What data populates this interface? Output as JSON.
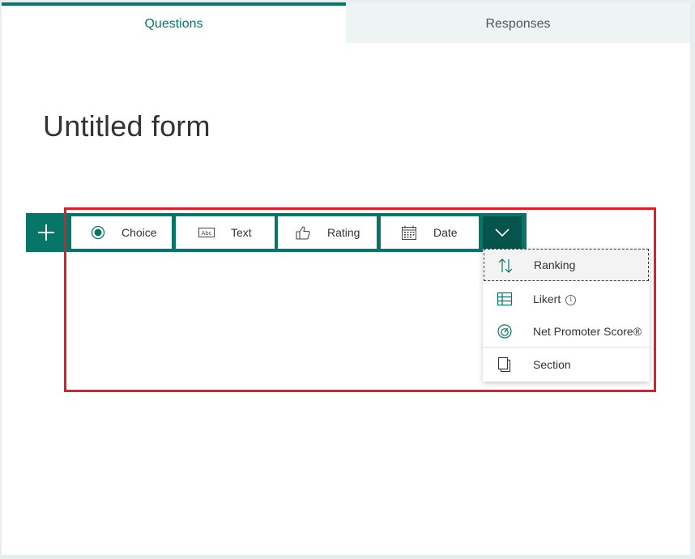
{
  "tabs": {
    "questions": "Questions",
    "responses": "Responses"
  },
  "form": {
    "title": "Untitled form"
  },
  "toolbar": {
    "choice": "Choice",
    "text": "Text",
    "rating": "Rating",
    "date": "Date"
  },
  "menu": {
    "ranking": "Ranking",
    "likert": "Likert",
    "likert_info": "i",
    "nps": "Net Promoter Score®",
    "section": "Section"
  },
  "colors": {
    "accent": "#077568",
    "accent_dark": "#05554c",
    "highlight": "#e01e2a"
  }
}
